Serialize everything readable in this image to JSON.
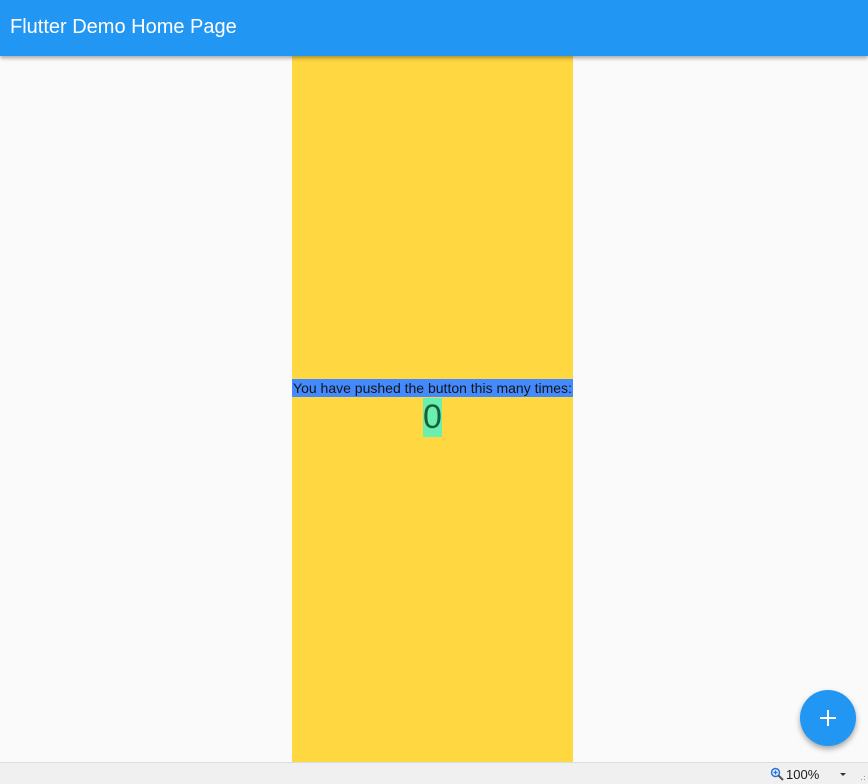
{
  "app_bar": {
    "title": "Flutter Demo Home Page",
    "color": "#2196f3"
  },
  "main": {
    "column_color": "#ffd740",
    "counter_label": "You have pushed the button this many times:",
    "counter_label_bg": "#448aff",
    "counter_value": "0",
    "counter_value_bg": "#69f0ae"
  },
  "fab": {
    "icon": "plus-icon",
    "color": "#2196f3"
  },
  "status_bar": {
    "zoom_icon": "zoom-icon",
    "zoom_level": "100%",
    "dropdown_icon": "chevron-down-icon"
  }
}
